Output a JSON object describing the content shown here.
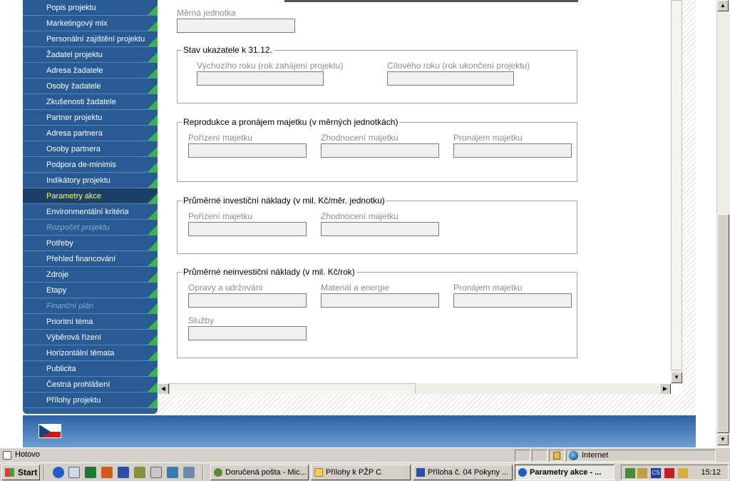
{
  "nav": {
    "items": [
      {
        "label": "Popis projektu",
        "state": "normal"
      },
      {
        "label": "Marketingový mix",
        "state": "normal"
      },
      {
        "label": "Personální zajištění projektu",
        "state": "normal"
      },
      {
        "label": "Žadatel projektu",
        "state": "normal"
      },
      {
        "label": "Adresa žadatele",
        "state": "normal"
      },
      {
        "label": "Osoby žadatele",
        "state": "normal"
      },
      {
        "label": "Zkušenosti žadatele",
        "state": "normal"
      },
      {
        "label": "Partner projektu",
        "state": "normal"
      },
      {
        "label": "Adresa partnera",
        "state": "normal"
      },
      {
        "label": "Osoby partnera",
        "state": "normal"
      },
      {
        "label": "Podpora de-minimis",
        "state": "normal"
      },
      {
        "label": "Indikátory projektu",
        "state": "normal"
      },
      {
        "label": "Parametry akce",
        "state": "active"
      },
      {
        "label": "Environmentální kritéria",
        "state": "normal"
      },
      {
        "label": "Rozpočet projektu",
        "state": "disabled"
      },
      {
        "label": "Potřeby",
        "state": "normal"
      },
      {
        "label": "Přehled financování",
        "state": "normal"
      },
      {
        "label": "Zdroje",
        "state": "normal"
      },
      {
        "label": "Etapy",
        "state": "normal"
      },
      {
        "label": "Finanční plán",
        "state": "disabled"
      },
      {
        "label": "Prioritní téma",
        "state": "normal"
      },
      {
        "label": "Výběrová řízení",
        "state": "normal"
      },
      {
        "label": "Horizontální témata",
        "state": "normal"
      },
      {
        "label": "Publicita",
        "state": "normal"
      },
      {
        "label": "Čestná prohlášení",
        "state": "normal"
      },
      {
        "label": "Přílohy projektu",
        "state": "normal"
      }
    ]
  },
  "form": {
    "unit_label": "Měrná jednotka",
    "stav": {
      "legend": "Stav ukazatele k 31.12.",
      "initial_label": "Výchozího roku (rok zahájení projektu)",
      "target_label": "Cílového roku (rok ukončení projektu)"
    },
    "repro": {
      "legend": "Reprodukce a pronájem majetku (v měrných jednotkách)",
      "f1": "Pořízení majetku",
      "f2": "Zhodnocení majetku",
      "f3": "Pronájem majetku"
    },
    "invest": {
      "legend": "Průměrné investiční náklady (v mil. Kč/měr. jednotku)",
      "f1": "Pořízení majetku",
      "f2": "Zhodnocení majetku"
    },
    "neinvest": {
      "legend": "Průměrné neinvestiční náklady (v mil. Kč/rok)",
      "f1": "Opravy a udržování",
      "f2": "Materiál a energie",
      "f3": "Pronájem majetku",
      "f4": "Služby"
    }
  },
  "status": {
    "text": "Hotovo",
    "zone": "Internet"
  },
  "taskbar": {
    "start": "Start",
    "tasks": [
      "Doručená pošta - Mic...",
      "Přílohy k PŽP C",
      "Příloha č. 04 Pokyny ...",
      "Parametry akce - ..."
    ],
    "clock": "15:12",
    "lang": "CS"
  },
  "colors": {
    "sidebar": "#2b5f98",
    "active": "#1d3f68",
    "accent": "#39b34a",
    "active_text": "#ffff66"
  }
}
